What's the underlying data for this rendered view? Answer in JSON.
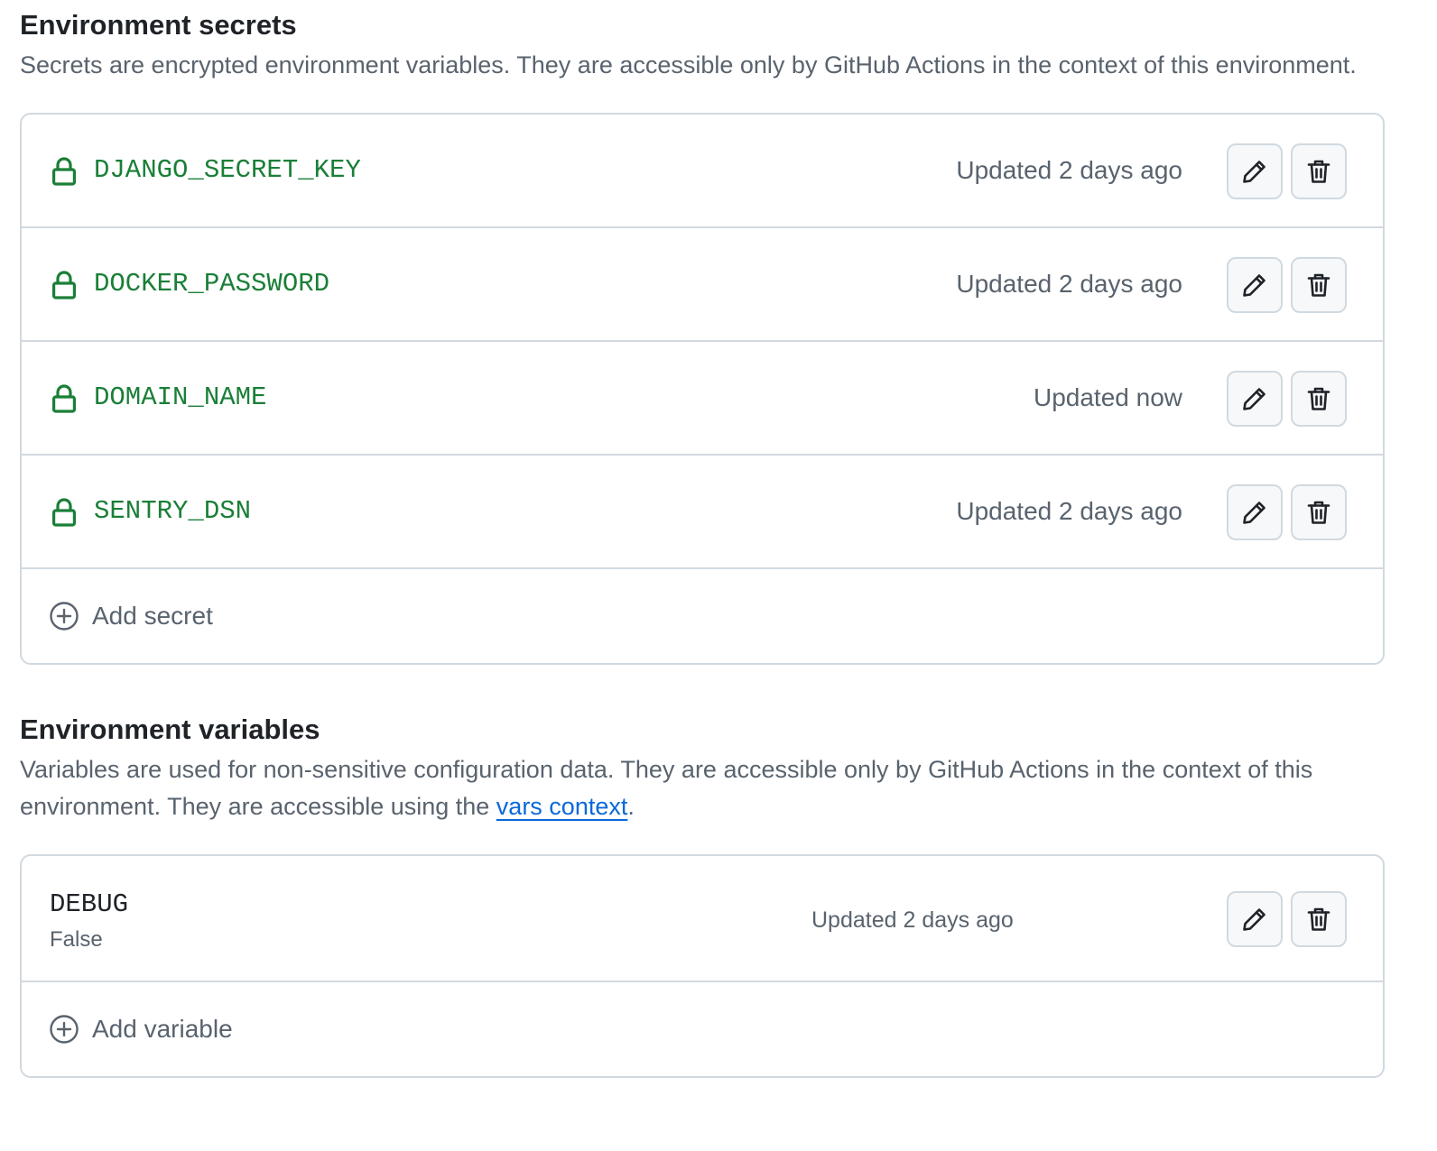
{
  "secrets_section": {
    "title": "Environment secrets",
    "description": "Secrets are encrypted environment variables. They are accessible only by GitHub Actions in the context of this environment.",
    "items": [
      {
        "name": "DJANGO_SECRET_KEY",
        "updated": "Updated 2 days ago"
      },
      {
        "name": "DOCKER_PASSWORD",
        "updated": "Updated 2 days ago"
      },
      {
        "name": "DOMAIN_NAME",
        "updated": "Updated now"
      },
      {
        "name": "SENTRY_DSN",
        "updated": "Updated 2 days ago"
      }
    ],
    "add_label": "Add secret"
  },
  "variables_section": {
    "title": "Environment variables",
    "description_prefix": "Variables are used for non-sensitive configuration data. They are accessible only by GitHub Actions in the context of this environment. They are accessible using the ",
    "link_text": "vars context",
    "description_suffix": ".",
    "items": [
      {
        "name": "DEBUG",
        "value": "False",
        "updated": "Updated 2 days ago"
      }
    ],
    "add_label": "Add variable"
  },
  "icons": {
    "lock": "lock-icon",
    "edit": "pencil-icon",
    "delete": "trash-icon",
    "add": "plus-circle-icon"
  },
  "colors": {
    "secret_name": "#1a7f37",
    "muted_text": "#59636e",
    "link": "#0969da",
    "border": "#d1d9e0",
    "button_bg": "#f6f8fa"
  }
}
